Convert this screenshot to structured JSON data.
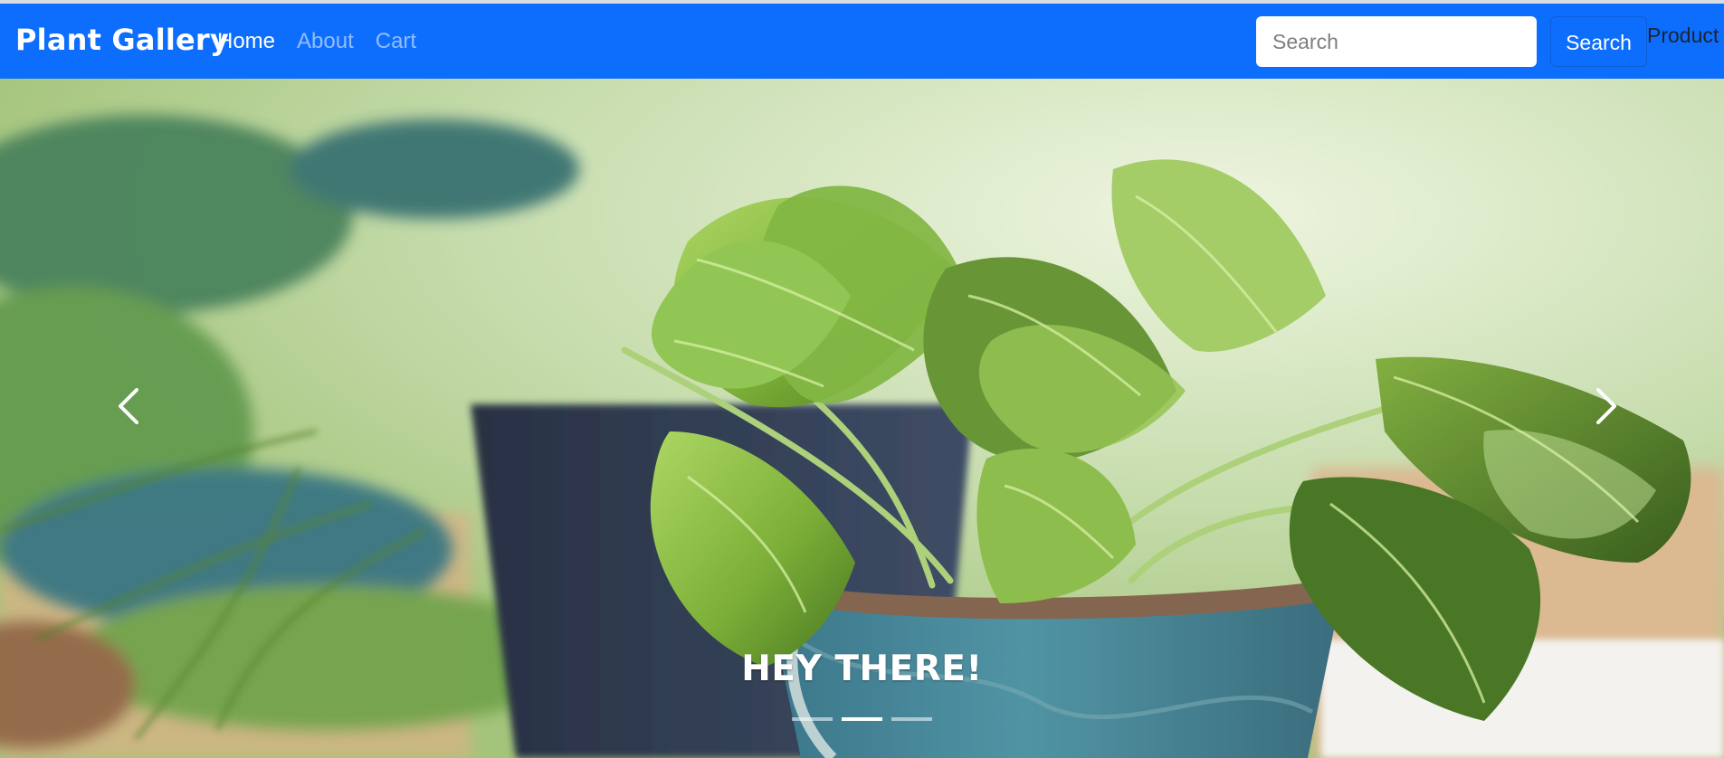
{
  "header": {
    "brand": "Plant Gallery",
    "nav": {
      "home": "Home",
      "about": "About",
      "cart": "Cart"
    },
    "search": {
      "placeholder": "Search",
      "button": "Search"
    },
    "product": "Product"
  },
  "carousel": {
    "caption": "HEY THERE!",
    "active_slide": 2,
    "slide_count": 3,
    "colors": {
      "navbar": "#0d6efd",
      "leaf_green": "#6aa82f",
      "pot_blue": "#3e7a8e",
      "dark_pot": "#25324a"
    }
  }
}
